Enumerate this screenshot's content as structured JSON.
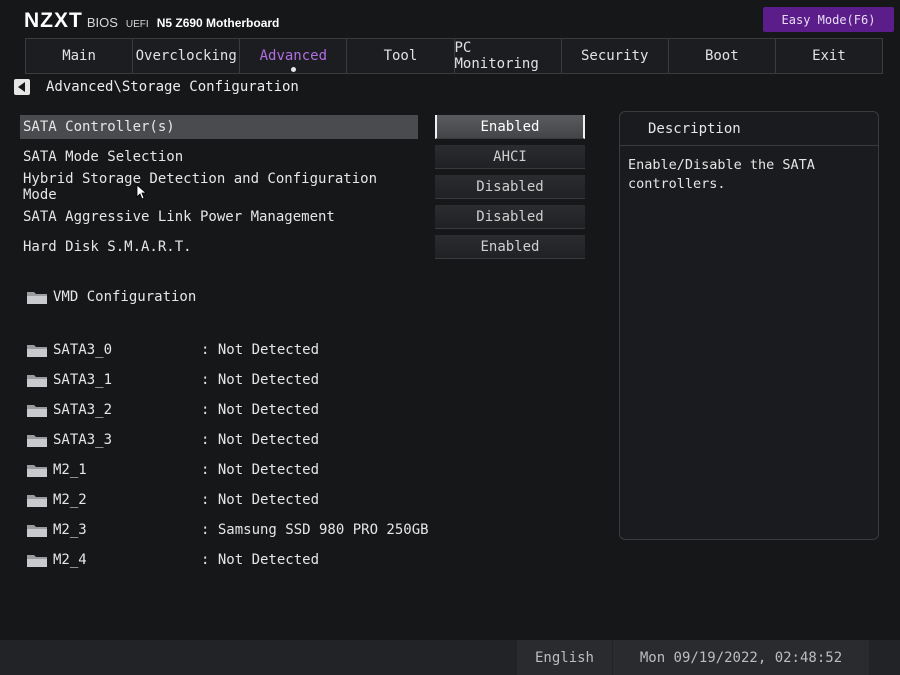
{
  "header": {
    "brand": "NZXT",
    "bios": "BIOS",
    "uefi": "UEFI",
    "model": "N5 Z690 Motherboard",
    "easy_mode": "Easy Mode(F6)"
  },
  "tabs": [
    {
      "label": "Main"
    },
    {
      "label": "Overclocking"
    },
    {
      "label": "Advanced",
      "active": true
    },
    {
      "label": "Tool"
    },
    {
      "label": "PC Monitoring"
    },
    {
      "label": "Security"
    },
    {
      "label": "Boot"
    },
    {
      "label": "Exit"
    }
  ],
  "breadcrumb": "Advanced\\Storage Configuration",
  "settings": [
    {
      "label": "SATA Controller(s)",
      "value": "Enabled",
      "selected": true
    },
    {
      "label": "SATA Mode Selection",
      "value": "AHCI"
    },
    {
      "label": "Hybrid Storage Detection and Configuration Mode",
      "value": "Disabled"
    },
    {
      "label": "SATA Aggressive Link Power Management",
      "value": "Disabled"
    },
    {
      "label": "Hard Disk S.M.A.R.T.",
      "value": "Enabled"
    }
  ],
  "vmd": {
    "label": "VMD Configuration"
  },
  "ports": [
    {
      "label": "SATA3_0",
      "status": ": Not Detected"
    },
    {
      "label": "SATA3_1",
      "status": ": Not Detected"
    },
    {
      "label": "SATA3_2",
      "status": ": Not Detected"
    },
    {
      "label": "SATA3_3",
      "status": ": Not Detected"
    },
    {
      "label": "M2_1",
      "status": ": Not Detected"
    },
    {
      "label": "M2_2",
      "status": ": Not Detected"
    },
    {
      "label": "M2_3",
      "status": ": Samsung SSD 980 PRO 250GB"
    },
    {
      "label": "M2_4",
      "status": ": Not Detected"
    }
  ],
  "description": {
    "title": "Description",
    "text": "Enable/Disable the SATA\ncontrollers."
  },
  "footer": {
    "language": "English",
    "datetime": "Mon 09/19/2022, 02:48:52"
  },
  "colors": {
    "accent": "#b06ee0",
    "easy_mode_bg": "#5a1d8a",
    "background": "#161719"
  }
}
